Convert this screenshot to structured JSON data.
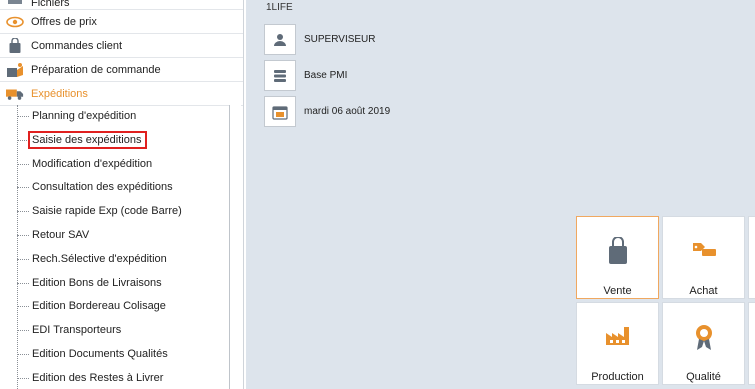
{
  "nav": {
    "top_items": [
      {
        "label": "Fichiers",
        "icon": "folder-icon"
      },
      {
        "label": "Offres de prix",
        "icon": "eye-icon"
      },
      {
        "label": "Commandes client",
        "icon": "shopping-bag-icon"
      },
      {
        "label": "Préparation de commande",
        "icon": "package-icon"
      },
      {
        "label": "Expéditions",
        "icon": "truck-icon",
        "active": true
      }
    ],
    "sub_items": [
      "Planning d'expédition",
      "Saisie des expéditions",
      "Modification d'expédition",
      "Consultation des expéditions",
      "Saisie rapide Exp (code Barre)",
      "Retour SAV",
      "Rech.Sélective d'expédition",
      "Edition Bons de Livraisons",
      "Edition Bordereau Colisage",
      "EDI Transporteurs",
      "Edition Documents Qualités",
      "Edition des Restes à Livrer"
    ],
    "highlighted_sub_item": "Saisie des expéditions"
  },
  "main": {
    "brand": "1LIFE",
    "info": {
      "user": "SUPERVISEUR",
      "database": "Base PMI",
      "date": "mardi 06 août 2019"
    },
    "tiles": [
      {
        "label": "Vente",
        "icon": "shopping-bag-icon",
        "selected": true
      },
      {
        "label": "Achat",
        "icon": "tag-hand-icon"
      },
      {
        "label": "Production",
        "icon": "factory-icon"
      },
      {
        "label": "Qualité",
        "icon": "award-badge-icon"
      }
    ]
  },
  "colors": {
    "accent": "#e8912d",
    "main_bg": "#dde4ec",
    "highlight_box": "#e0201f",
    "icon_gray": "#5f6b78"
  }
}
